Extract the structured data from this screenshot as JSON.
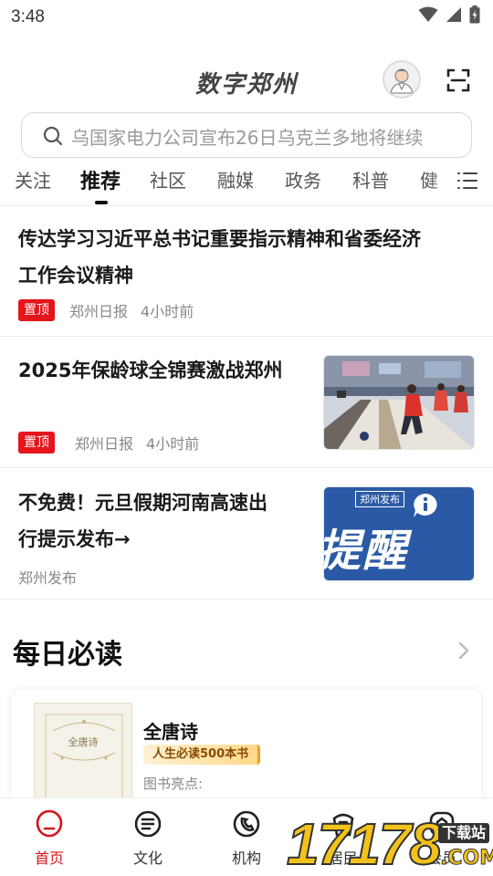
{
  "status_bar": {
    "time": "3:48"
  },
  "header": {
    "title": "数字郑州"
  },
  "search": {
    "placeholder": "乌国家电力公司宣布26日乌克兰多地将继续"
  },
  "tabs": [
    {
      "label": "关注",
      "active": false
    },
    {
      "label": "推荐",
      "active": true
    },
    {
      "label": "社区",
      "active": false
    },
    {
      "label": "融媒",
      "active": false
    },
    {
      "label": "政务",
      "active": false
    },
    {
      "label": "科普",
      "active": false
    },
    {
      "label": "健",
      "active": false
    }
  ],
  "news": [
    {
      "title_line1": "传达学习习近平总书记重要指示精神和省委经济",
      "title_line2": "工作会议精神",
      "badge": "置顶",
      "source": "郑州日报",
      "time": "4小时前"
    },
    {
      "title_line1": "2025年保龄球全锦赛激战郑州",
      "badge": "置顶",
      "source": "郑州日报",
      "time": "4小时前"
    },
    {
      "title_line1": "不免费！元旦假期河南高速出",
      "title_line2": "行提示发布→",
      "source": "郑州发布",
      "thumb_text": "提醒",
      "thumb_brand": "郑州发布"
    }
  ],
  "daily": {
    "title": "每日必读",
    "book": {
      "name": "全唐诗",
      "tag": "人生必读500本书",
      "desc": "图书亮点:",
      "cover_text": "全唐诗"
    }
  },
  "bottom_nav": [
    {
      "label": "首页",
      "icon": "home-icon",
      "active": true
    },
    {
      "label": "文化",
      "icon": "culture-icon",
      "active": false
    },
    {
      "label": "机构",
      "icon": "organization-icon",
      "active": false
    },
    {
      "label": "居民",
      "icon": "resident-icon",
      "active": false
    },
    {
      "label": "会员",
      "icon": "member-icon",
      "active": false
    }
  ],
  "watermark": {
    "brand": "17178",
    "tag": "下载站",
    "suffix": ".COM"
  },
  "colors": {
    "accent": "#d4141b",
    "badge": "#e4151b",
    "text": "#1a1a1a",
    "muted": "#888888"
  }
}
